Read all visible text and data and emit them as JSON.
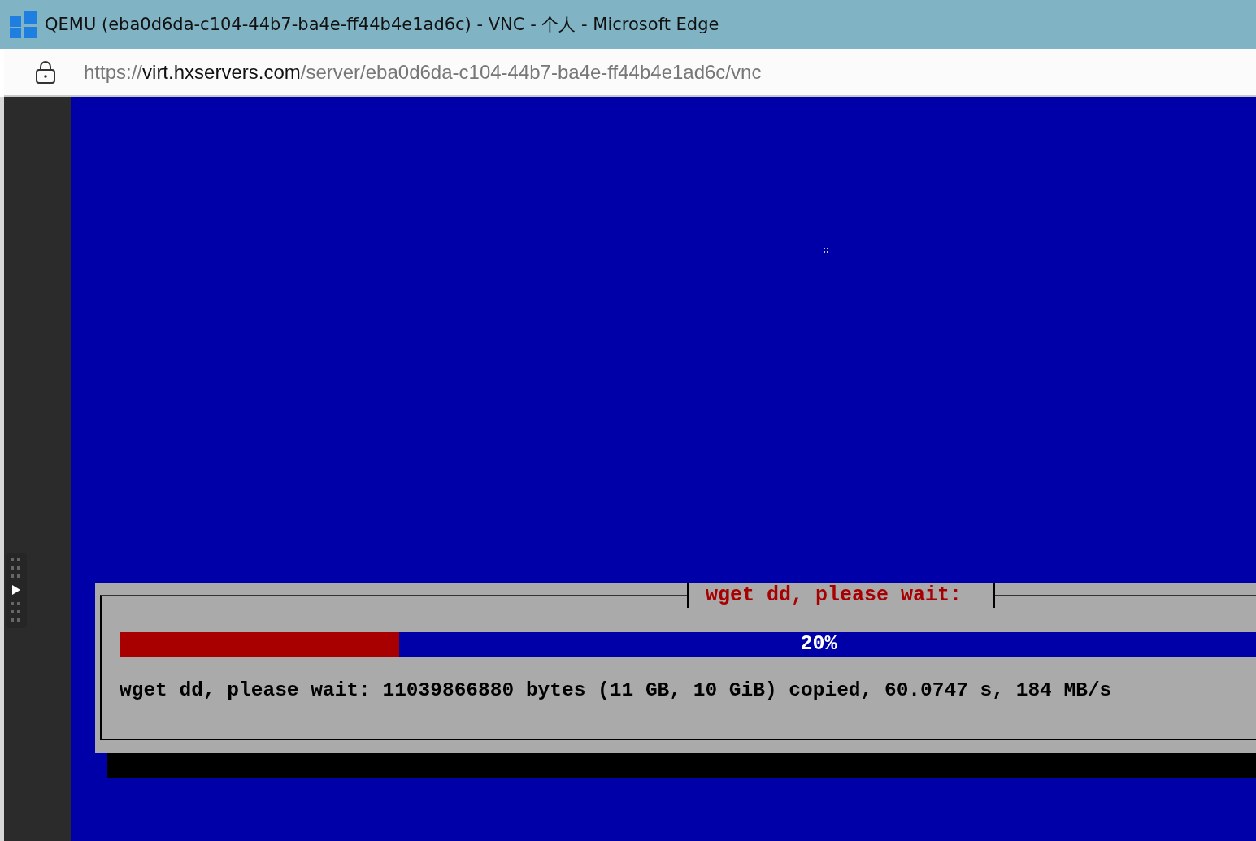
{
  "window": {
    "title": "QEMU (eba0d6da-c104-44b7-ba4e-ff44b4e1ad6c) - VNC - 个人 - Microsoft Edge"
  },
  "address_bar": {
    "scheme": "https://",
    "host": "virt.hxservers.com",
    "path": "/server/eba0d6da-c104-44b7-ba4e-ff44b4e1ad6c/vnc"
  },
  "dialog": {
    "title": "wget dd, please wait:",
    "progress": {
      "level": 0.2,
      "reading": "20%"
    },
    "message": "wget dd, please wait: 11039866880 bytes (11 GB, 10 GiB) copied, 60.0747 s, 184 MB/s"
  }
}
